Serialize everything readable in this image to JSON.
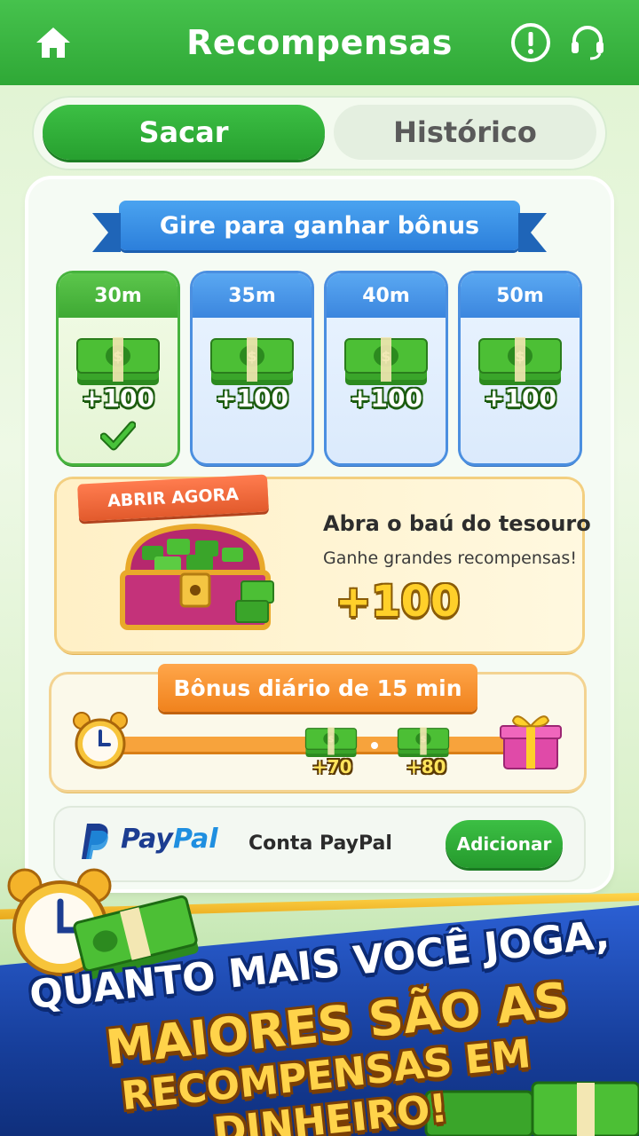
{
  "header": {
    "title": "Recompensas",
    "home_icon": "home-icon",
    "alert_icon": "alert-icon",
    "support_icon": "headset-icon"
  },
  "tabs": {
    "active": "Sacar",
    "inactive": "Histórico"
  },
  "spin": {
    "title": "Gire para ganhar bônus",
    "cards": [
      {
        "time": "30m",
        "amount": "+100",
        "claimed": true
      },
      {
        "time": "35m",
        "amount": "+100",
        "claimed": false
      },
      {
        "time": "40m",
        "amount": "+100",
        "claimed": false
      },
      {
        "time": "50m",
        "amount": "+100",
        "claimed": false
      }
    ]
  },
  "treasure": {
    "badge": "ABRIR AGORA",
    "title": "Abra o baú do tesouro",
    "subtitle": "Ganhe grandes recompensas!",
    "amount": "+100"
  },
  "daily": {
    "title": "Bônus diário de 15 min",
    "rewards": [
      "+70",
      "+80"
    ]
  },
  "paypal": {
    "brand_a": "Pay",
    "brand_b": "Pal",
    "label": "Conta PayPal",
    "button": "Adicionar"
  },
  "promo": {
    "line1": "QUANTO MAIS VOCÊ JOGA,",
    "line2": "MAIORES SÃO AS",
    "line3": "RECOMPENSAS EM DINHEIRO!"
  },
  "colors": {
    "green": "#2fa836",
    "blue": "#2c7fdb",
    "orange": "#f0821d",
    "gold": "#ffd34a"
  }
}
